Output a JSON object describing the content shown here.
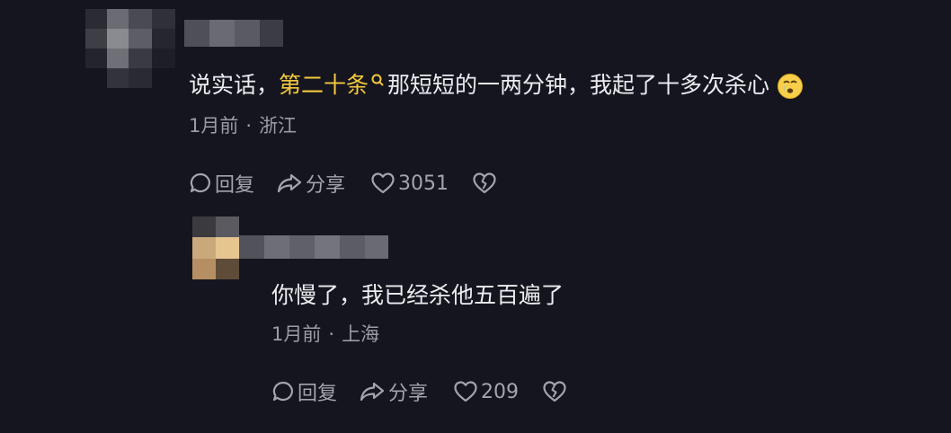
{
  "comments": [
    {
      "text_before": "说实话，",
      "highlight": "第二十条",
      "text_after": "那短短的一两分钟，我起了十多次杀心",
      "time": "1月前",
      "location": "浙江",
      "reply_label": "回复",
      "share_label": "分享",
      "likes": "3051",
      "emoji_icon": "crying-face-emoji"
    },
    {
      "text": "你慢了，我已经杀他五百遍了",
      "time": "1月前",
      "location": "上海",
      "reply_label": "回复",
      "share_label": "分享",
      "likes": "209"
    }
  ],
  "colors": {
    "background": "#15151f",
    "text": "#ececf0",
    "highlight": "#f3c93d",
    "meta": "#9c9ca6"
  },
  "separator": "·"
}
